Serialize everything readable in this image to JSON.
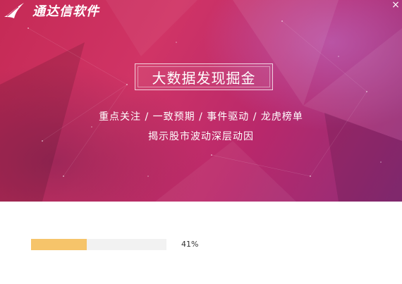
{
  "brand": {
    "name": "通达信软件",
    "logo_icon": "tdx-logo-icon"
  },
  "window": {
    "close_icon": "close-icon",
    "close_glyph": "×"
  },
  "banner": {
    "headline": "大数据发现掘金",
    "features": [
      "重点关注",
      "一致预期",
      "事件驱动",
      "龙虎榜单"
    ],
    "features_line": "重点关注 / 一致预期 / 事件驱动 / 龙虎榜单",
    "tagline": "揭示股市波动深层动因"
  },
  "progress": {
    "fraction": 0.41,
    "label": "41%"
  },
  "colors": {
    "banner_primary": "#c52a55",
    "banner_secondary": "#8e2f7a",
    "progress_fill": "#f6c46a",
    "progress_track": "#f2f2f2"
  }
}
